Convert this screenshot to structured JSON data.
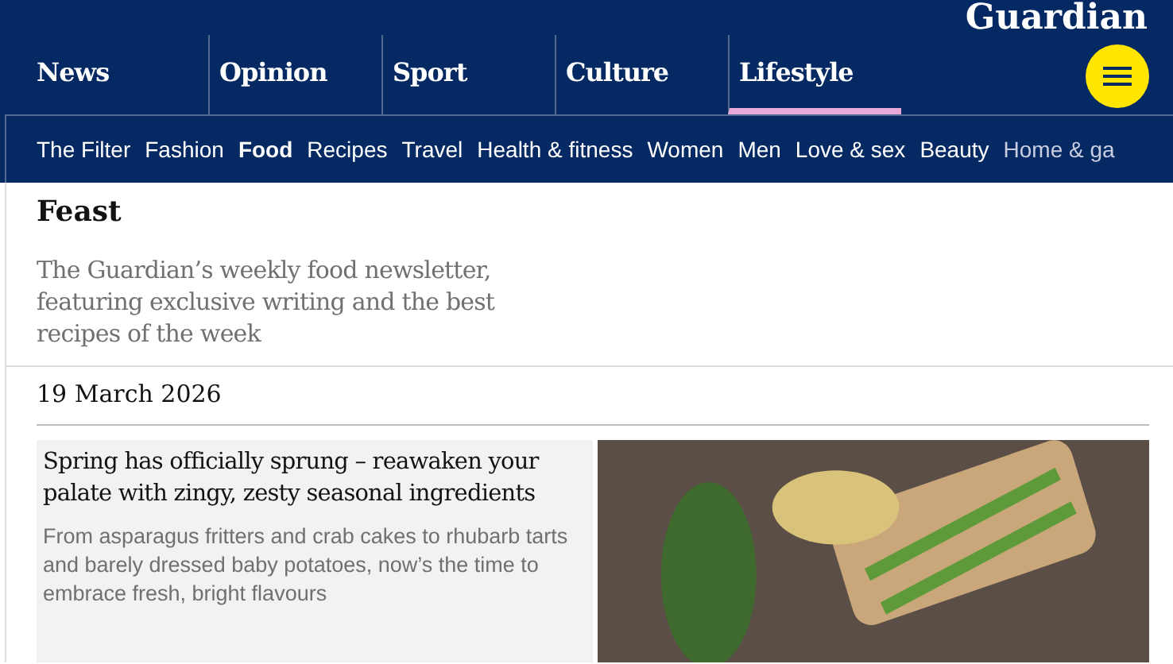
{
  "header": {
    "logo": "Guardian"
  },
  "pillars": [
    {
      "label": "News",
      "selected": false
    },
    {
      "label": "Opinion",
      "selected": false
    },
    {
      "label": "Sport",
      "selected": false
    },
    {
      "label": "Culture",
      "selected": false
    },
    {
      "label": "Lifestyle",
      "selected": true
    }
  ],
  "subnav": [
    {
      "label": "The Filter",
      "selected": false
    },
    {
      "label": "Fashion",
      "selected": false
    },
    {
      "label": "Food",
      "selected": true
    },
    {
      "label": "Recipes",
      "selected": false
    },
    {
      "label": "Travel",
      "selected": false
    },
    {
      "label": "Health & fitness",
      "selected": false
    },
    {
      "label": "Women",
      "selected": false
    },
    {
      "label": "Men",
      "selected": false
    },
    {
      "label": "Love & sex",
      "selected": false
    },
    {
      "label": "Beauty",
      "selected": false
    },
    {
      "label": "Home & ga",
      "selected": false
    }
  ],
  "section": {
    "title": "Feast",
    "description": "The Guardian’s weekly food newsletter, featuring exclusive writing and the best recipes of the week"
  },
  "date": "19 March 2026",
  "article": {
    "headline": "Spring has officially sprung – reawaken your palate with zingy, zesty seasonal ingredients",
    "standfirst": "From asparagus fritters and crab cakes to rhubarb tarts and barely dressed baby potatoes, now’s the time to embrace fresh, bright flavours"
  }
}
